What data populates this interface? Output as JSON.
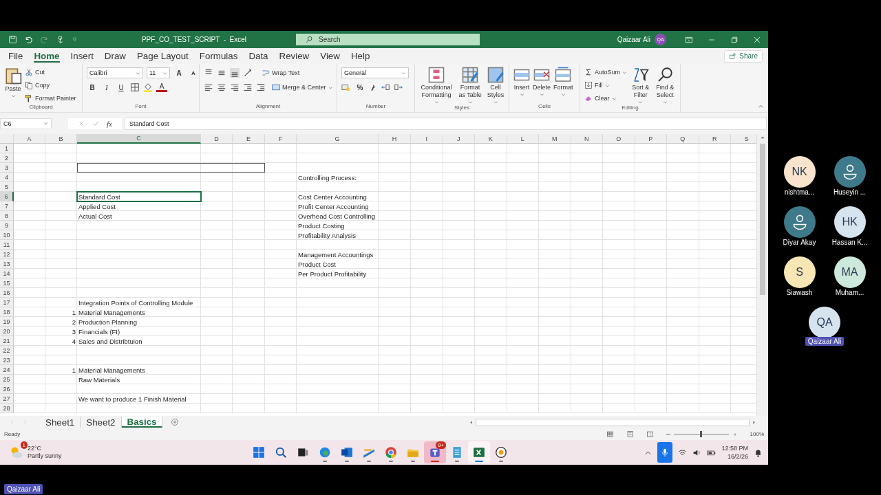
{
  "title_bar": {
    "title": "PPF_CO_TEST_SCRIPT  -  Excel",
    "search": {
      "placeholder": "Search"
    },
    "user": "Qaizaar Ali",
    "avatar": "QA"
  },
  "tabs": [
    {
      "label": "File",
      "selected": false
    },
    {
      "label": "Home",
      "selected": true
    },
    {
      "label": "Insert",
      "selected": false
    },
    {
      "label": "Draw",
      "selected": false
    },
    {
      "label": "Page Layout",
      "selected": false
    },
    {
      "label": "Formulas",
      "selected": false
    },
    {
      "label": "Data",
      "selected": false
    },
    {
      "label": "Review",
      "selected": false
    },
    {
      "label": "View",
      "selected": false
    },
    {
      "label": "Help",
      "selected": false
    }
  ],
  "share": "Share",
  "ribbon": {
    "groups": [
      {
        "kind": "clipboard",
        "label": "Clipboard",
        "paste": "Paste",
        "items": [
          "Cut",
          "Copy",
          "Format Painter"
        ]
      },
      {
        "kind": "font",
        "label": "Font",
        "font_name": "Calibri",
        "font_size": "11",
        "grow": "A",
        "shrink": "A",
        "styles": [
          "B",
          "I",
          "U"
        ],
        "font_color": "A"
      },
      {
        "kind": "alignment",
        "label": "Alignment",
        "wrap": "Wrap Text",
        "merge": "Merge & Center"
      },
      {
        "kind": "number",
        "label": "Number",
        "format": "General",
        "percent": "%"
      },
      {
        "kind": "styles",
        "label": "Styles",
        "items": [
          "Conditional Formatting",
          "Format as Table",
          "Cell Styles"
        ]
      },
      {
        "kind": "cells",
        "label": "Cells",
        "items": [
          "Insert",
          "Delete",
          "Format"
        ]
      },
      {
        "kind": "editing",
        "label": "Editing",
        "items": [
          "AutoSum",
          "Fill",
          "Clear"
        ],
        "large": [
          "Sort & Filter",
          "Find & Select"
        ]
      }
    ]
  },
  "formula_bar": {
    "name_box": "C6",
    "function_label": "fx",
    "formula": "Standard Cost"
  },
  "sheet": {
    "columns": [
      {
        "label": "A",
        "selected": false
      },
      {
        "label": "B",
        "selected": false
      },
      {
        "label": "C",
        "selected": true
      },
      {
        "label": "D",
        "selected": false
      },
      {
        "label": "E",
        "selected": false
      },
      {
        "label": "F",
        "selected": false
      },
      {
        "label": "G",
        "selected": false
      },
      {
        "label": "H",
        "selected": false
      },
      {
        "label": "I",
        "selected": false
      },
      {
        "label": "J",
        "selected": false
      },
      {
        "label": "K",
        "selected": false
      },
      {
        "label": "L",
        "selected": false
      },
      {
        "label": "M",
        "selected": false
      },
      {
        "label": "N",
        "selected": false
      },
      {
        "label": "O",
        "selected": false
      },
      {
        "label": "P",
        "selected": false
      },
      {
        "label": "Q",
        "selected": false
      },
      {
        "label": "R",
        "selected": false
      },
      {
        "label": "S",
        "selected": false
      }
    ],
    "rows": [
      {
        "number": "1",
        "selected": false
      },
      {
        "number": "2",
        "selected": false
      },
      {
        "number": "3",
        "selected": false,
        "boxed": true
      },
      {
        "number": "4",
        "selected": false,
        "g": "Controlling Process:"
      },
      {
        "number": "5",
        "selected": false
      },
      {
        "number": "6",
        "selected": true,
        "c": "Standard Cost",
        "g": "Cost Center Accounting"
      },
      {
        "number": "7",
        "selected": false,
        "c": "Applied Cost",
        "g": "Profit Center Accounting"
      },
      {
        "number": "8",
        "selected": false,
        "c": "Actual Cost",
        "g": "Overhead Cost Controlling"
      },
      {
        "number": "9",
        "selected": false,
        "g": "Product Costing"
      },
      {
        "number": "10",
        "selected": false,
        "g": "Profitability Analysis"
      },
      {
        "number": "11",
        "selected": false
      },
      {
        "number": "12",
        "selected": false,
        "g": "Management Accountings"
      },
      {
        "number": "13",
        "selected": false,
        "g": "Product Cost"
      },
      {
        "number": "14",
        "selected": false,
        "g": "Per  Product Profitability"
      },
      {
        "number": "15",
        "selected": false
      },
      {
        "number": "16",
        "selected": false
      },
      {
        "number": "17",
        "selected": false,
        "c": "Integration Points of Controlling Module"
      },
      {
        "number": "18",
        "selected": false,
        "b": "1",
        "c": "Material Managements"
      },
      {
        "number": "19",
        "selected": false,
        "b": "2",
        "c": "Production Planning"
      },
      {
        "number": "20",
        "selected": false,
        "b": "3",
        "c": "Financials (FI)"
      },
      {
        "number": "21",
        "selected": false,
        "b": "4",
        "c": "Sales and Distribtuion"
      },
      {
        "number": "22",
        "selected": false
      },
      {
        "number": "23",
        "selected": false
      },
      {
        "number": "24",
        "selected": false,
        "b": "1",
        "c": "Material Managements"
      },
      {
        "number": "25",
        "selected": false,
        "c": "Raw Materials"
      },
      {
        "number": "26",
        "selected": false
      },
      {
        "number": "27",
        "selected": false,
        "c": "We want to produce 1 Finish Material"
      },
      {
        "number": "28",
        "selected": false
      }
    ]
  },
  "sheet_tabs": [
    {
      "label": "Sheet1",
      "selected": false
    },
    {
      "label": "Sheet2",
      "selected": false
    },
    {
      "label": "Basics",
      "selected": true
    }
  ],
  "status_bar": {
    "status": "Ready",
    "zoom_slider": {
      "level": 0.5
    },
    "zoom": "100%"
  },
  "taskbar": {
    "weather_badge": "1",
    "temperature": "22°C",
    "weather": "Partly sunny",
    "apps": [
      {
        "kind": "start",
        "running": false,
        "active": false,
        "attention": false
      },
      {
        "kind": "search",
        "running": false,
        "active": false,
        "attention": false
      },
      {
        "kind": "taskview",
        "running": false,
        "active": false,
        "attention": false
      },
      {
        "kind": "edge",
        "running": true,
        "active": false,
        "attention": false
      },
      {
        "kind": "outlook",
        "running": true,
        "active": false,
        "attention": false
      },
      {
        "kind": "whiteboard",
        "running": true,
        "active": false,
        "attention": false
      },
      {
        "kind": "chrome",
        "running": true,
        "active": false,
        "attention": false
      },
      {
        "kind": "explorer",
        "running": true,
        "active": false,
        "attention": false
      },
      {
        "kind": "teams",
        "running": true,
        "active": false,
        "attention": true,
        "badge": "9+"
      },
      {
        "kind": "notepad",
        "running": true,
        "active": false,
        "attention": false
      },
      {
        "kind": "excel",
        "running": true,
        "active": true,
        "attention": false
      },
      {
        "kind": "recorder",
        "running": true,
        "active": false,
        "attention": false
      }
    ],
    "time": "12:58 PM",
    "date": "16/2/26"
  },
  "participants": [
    {
      "kind": "initials",
      "initials": "NK",
      "name": "nishtma...",
      "color": "#f8e4cc",
      "self": false
    },
    {
      "kind": "silhouette",
      "name": "Huseyin ...",
      "color": "#3e7a8a",
      "self": false
    },
    {
      "kind": "silhouette",
      "name": "Diyar Akay",
      "color": "#3e7a8a",
      "self": false
    },
    {
      "kind": "initials",
      "initials": "HK",
      "name": "Hassan K...",
      "color": "#d6e4f0",
      "self": false
    },
    {
      "kind": "initials",
      "initials": "S",
      "name": "Siawash",
      "color": "#f7e7b4",
      "self": false
    },
    {
      "kind": "initials",
      "initials": "MA",
      "name": "Muham...",
      "color": "#cde9db",
      "self": false
    },
    {
      "kind": "initials",
      "initials": "QA",
      "name": "Qaizaar Ali",
      "color": "#d6e4f0",
      "self": true
    }
  ],
  "presenter_label": "Qaizaar Ali"
}
